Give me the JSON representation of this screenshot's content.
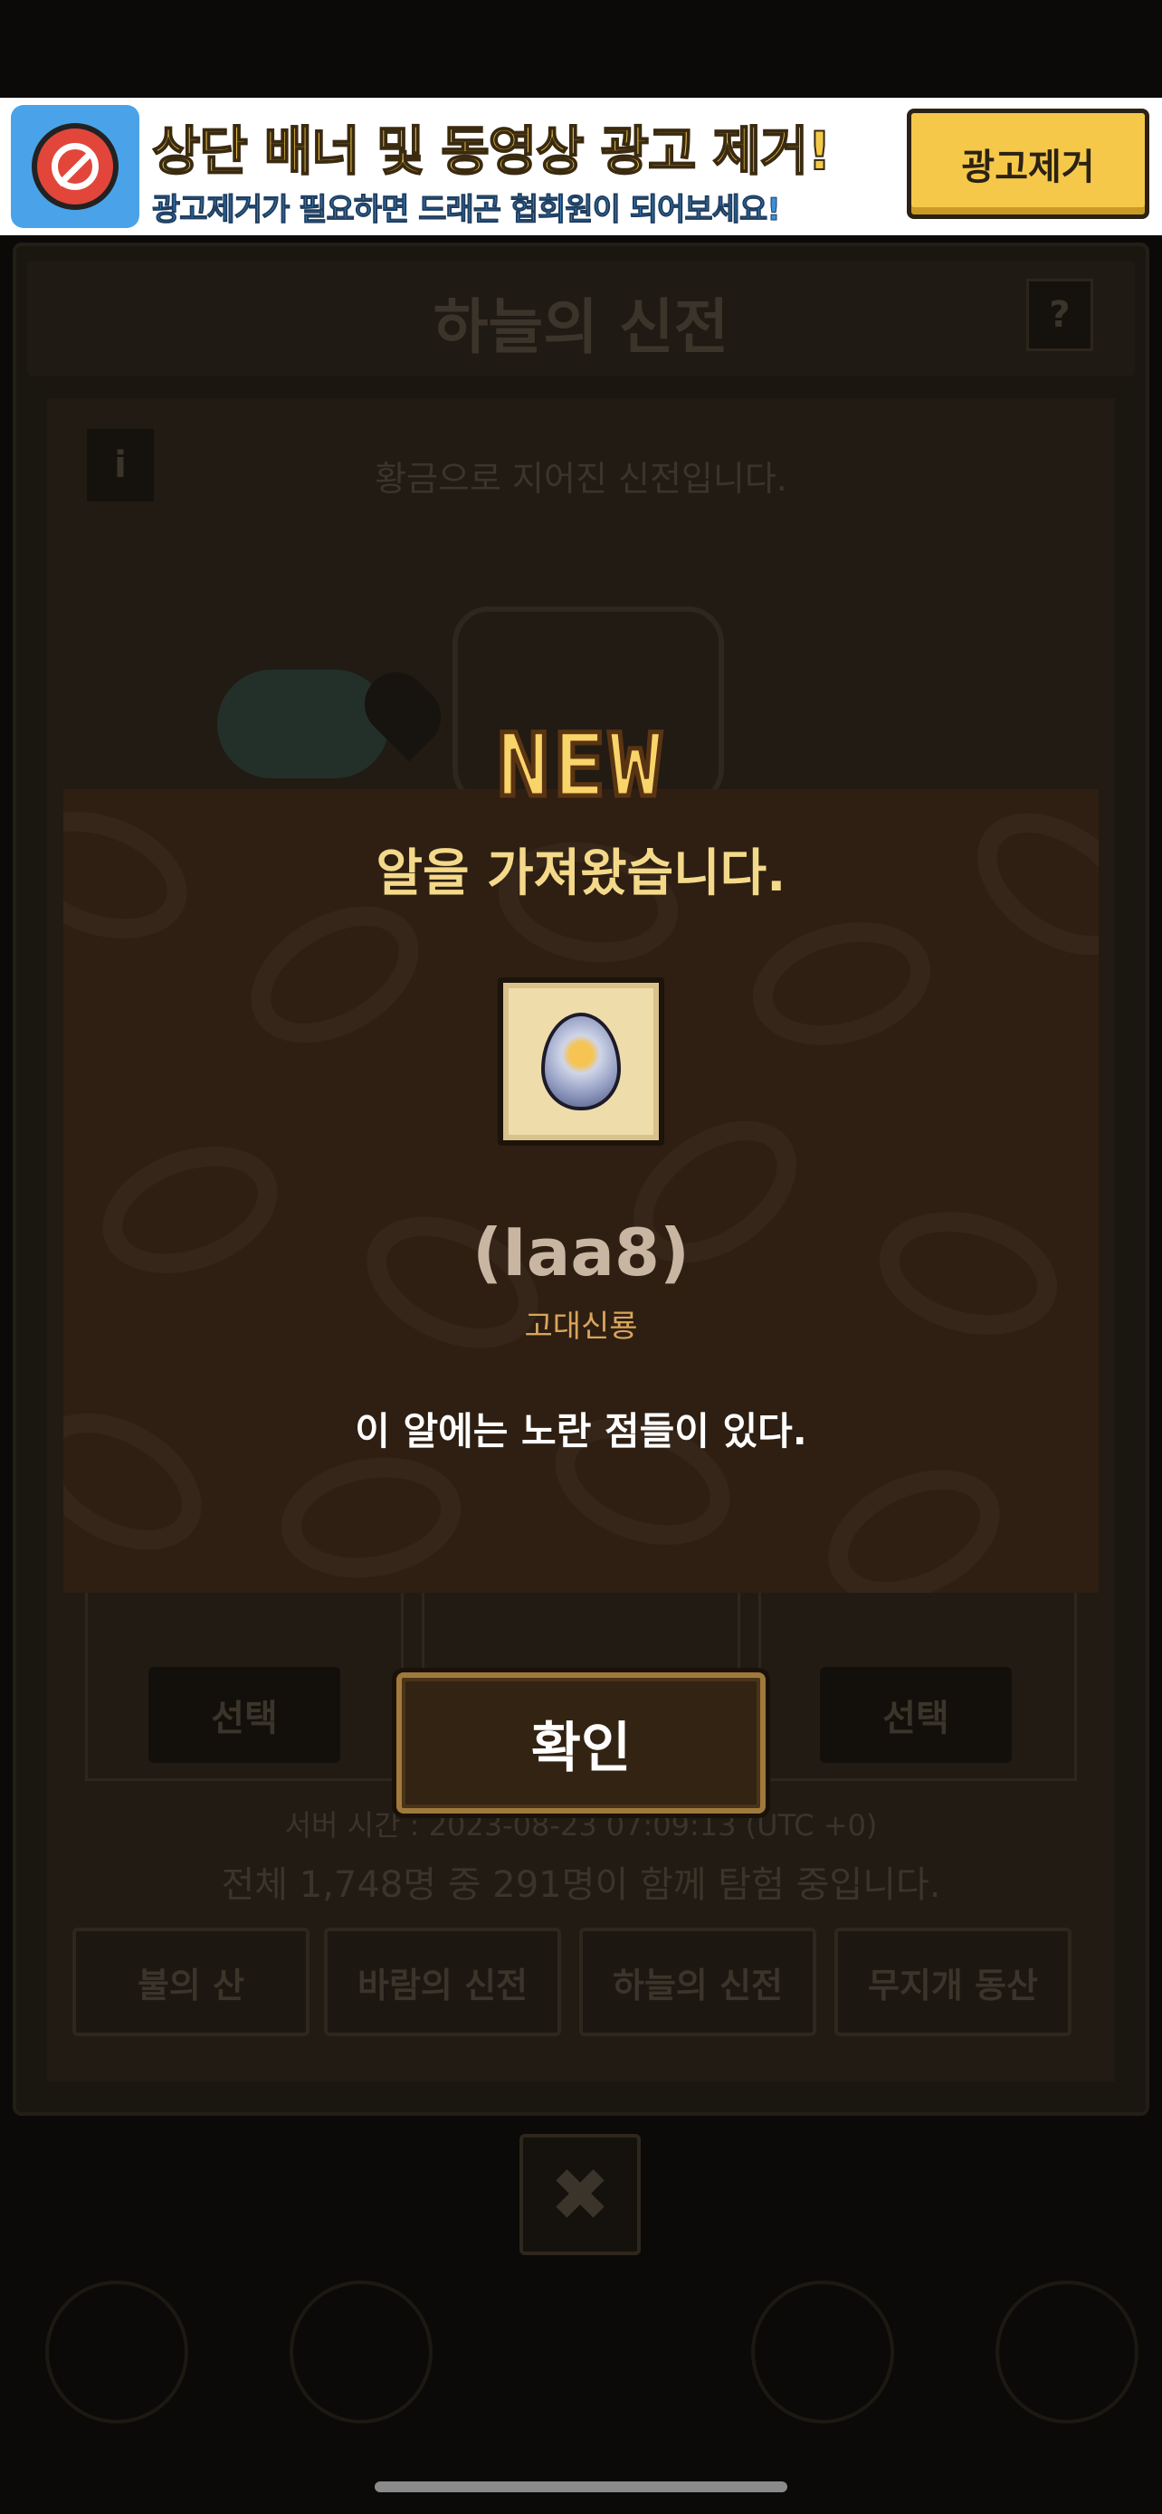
{
  "ad": {
    "title": "상단 배너 및 동영상 광고 제거!",
    "subtitle": "광고제거가 필요하면 드래곤 협회원이 되어보세요!",
    "button_label": "광고제거"
  },
  "background": {
    "title": "하늘의 신전",
    "help_label": "?",
    "info_label": "i",
    "description": "황금으로 지어진 신전입니다.",
    "select_labels": [
      "선택",
      "선택"
    ],
    "server_time": "서버 시간 : 2023-08-23 07:09:13 (UTC +0)",
    "participants": "전체 1,748명 중 291명이 함께 탐험 중입니다.",
    "tabs": [
      "불의 산",
      "바람의 신전",
      "하늘의 신전",
      "무지개 동산"
    ],
    "close_label": "✖"
  },
  "modal": {
    "badge": "NEW",
    "title": "알을 가져왔습니다.",
    "item_code": "(Iaa8)",
    "item_type": "고대신룡",
    "item_description": "이 알에는 노란 점들이 있다.",
    "confirm_label": "확인",
    "icon": "egg-icon"
  }
}
